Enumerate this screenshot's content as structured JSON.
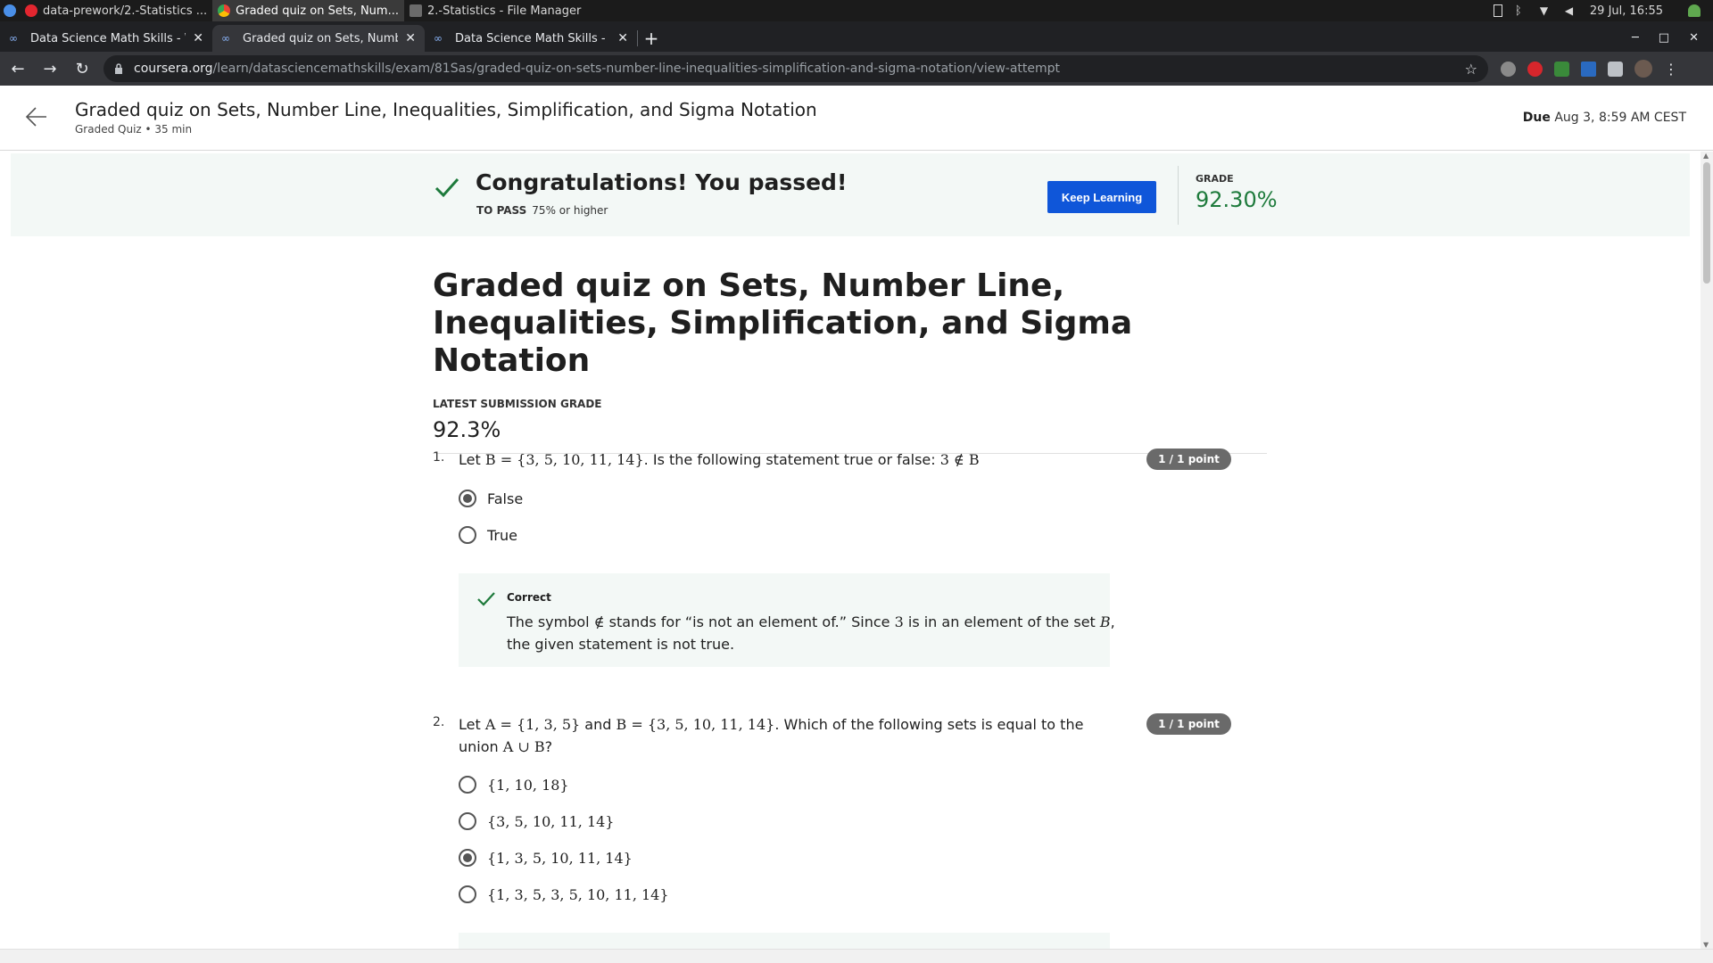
{
  "os_bar": {
    "tasks": [
      "data-prework/2.-Statistics ...",
      "Graded quiz on Sets, Num...",
      "2.-Statistics - File Manager"
    ],
    "clock": "29 Jul, 16:55"
  },
  "browser": {
    "tabs": [
      {
        "title": "Data Science Math Skills - Wel"
      },
      {
        "title": "Graded quiz on Sets, Number"
      },
      {
        "title": "Data Science Math Skills - Hom"
      }
    ],
    "url_host": "coursera.org",
    "url_path": "/learn/datasciencemathskills/exam/81Sas/graded-quiz-on-sets-number-line-inequalities-simplification-and-sigma-notation/view-attempt"
  },
  "header": {
    "title": "Graded quiz on Sets, Number Line, Inequalities, Simplification, and Sigma Notation",
    "subtitle": "Graded Quiz • 35 min",
    "due_label": "Due",
    "due_value": "Aug 3, 8:59 AM CEST"
  },
  "banner": {
    "title": "Congratulations! You passed!",
    "to_pass_label": "TO PASS",
    "to_pass_value": "75% or higher",
    "button_label": "Keep Learning",
    "grade_label": "GRADE",
    "grade_value": "92.30%"
  },
  "main": {
    "title": "Graded quiz on Sets, Number Line, Inequalities, Simplification, and Sigma Notation",
    "latest_label": "LATEST SUBMISSION GRADE",
    "latest_value": "92.3%"
  },
  "questions": [
    {
      "number": "1.",
      "text_pre": "Let ",
      "math1": "B = {3, 5, 10, 11, 14}",
      "text_mid": ". Is the following statement true or false: ",
      "math2": "3 ∉ B",
      "badge": "1 / 1 point",
      "options": [
        {
          "label": "False",
          "selected": true
        },
        {
          "label": "True",
          "selected": false
        }
      ],
      "feedback": {
        "title": "Correct",
        "t1": "The symbol ",
        "m1": "∉",
        "t2": " stands for “is not an element of.” Since ",
        "m2": "3",
        "t3": " is in an element of the set ",
        "m3": "B",
        "t4": ", the given statement is not true."
      }
    },
    {
      "number": "2.",
      "text_pre": "Let ",
      "math1": "A = {1, 3, 5}",
      "text_mid": " and ",
      "math2": "B = {3, 5, 10, 11, 14}",
      "text_post": ". Which of the following sets is equal to the union ",
      "math3": "A ∪ B",
      "text_end": "?",
      "badge": "1 / 1 point",
      "options": [
        {
          "label": "{1, 10, 18}",
          "selected": false
        },
        {
          "label": "{3, 5, 10, 11, 14}",
          "selected": false
        },
        {
          "label": "{1, 3, 5, 10, 11, 14}",
          "selected": true
        },
        {
          "label": "{1, 3, 5, 3, 5, 10, 11, 14}",
          "selected": false
        }
      ]
    }
  ]
}
